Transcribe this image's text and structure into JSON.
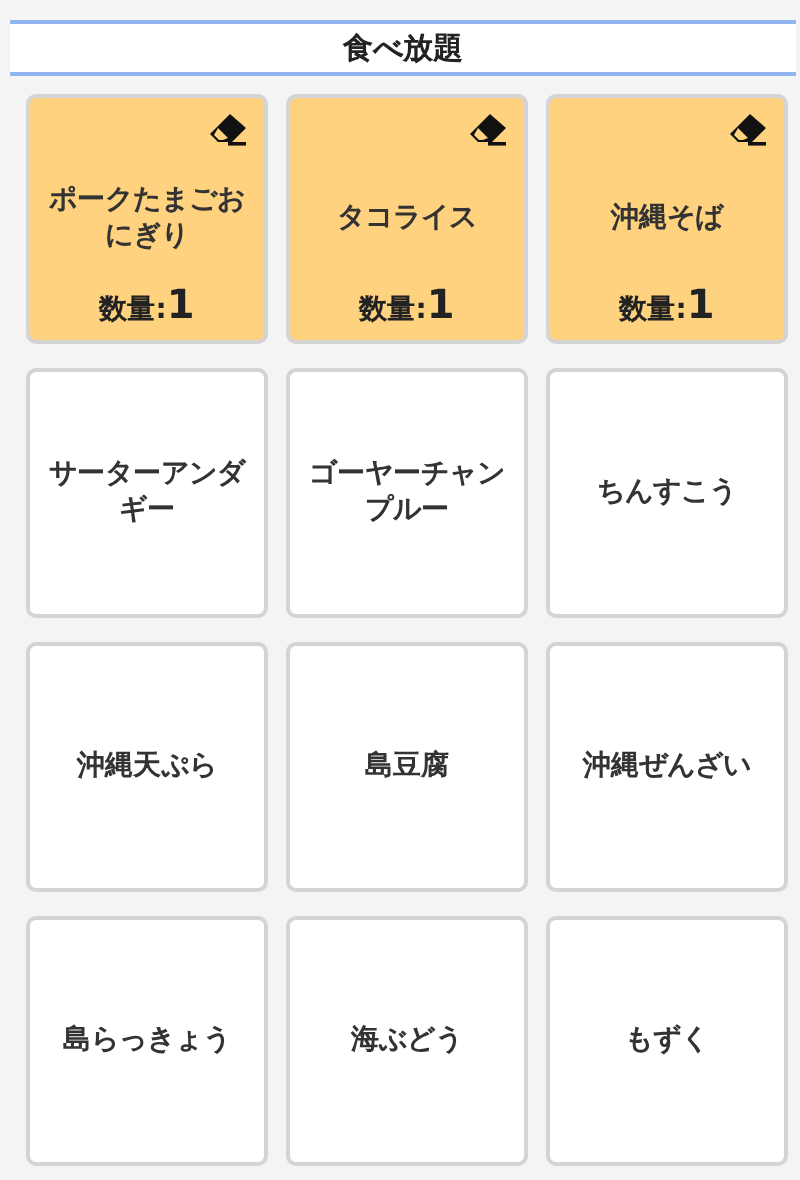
{
  "header": {
    "title": "食べ放題"
  },
  "items": [
    {
      "name": "ポークたまごおにぎり",
      "selected": true,
      "quantity_label": "数量:",
      "quantity": "1"
    },
    {
      "name": "タコライス",
      "selected": true,
      "quantity_label": "数量:",
      "quantity": "1"
    },
    {
      "name": "沖縄そば",
      "selected": true,
      "quantity_label": "数量:",
      "quantity": "1"
    },
    {
      "name": "サーターアンダギー",
      "selected": false
    },
    {
      "name": "ゴーヤーチャンプルー",
      "selected": false
    },
    {
      "name": "ちんすこう",
      "selected": false
    },
    {
      "name": "沖縄天ぷら",
      "selected": false
    },
    {
      "name": "島豆腐",
      "selected": false
    },
    {
      "name": "沖縄ぜんざい",
      "selected": false
    },
    {
      "name": "島らっきょう",
      "selected": false
    },
    {
      "name": "海ぶどう",
      "selected": false
    },
    {
      "name": "もずく",
      "selected": false
    }
  ]
}
